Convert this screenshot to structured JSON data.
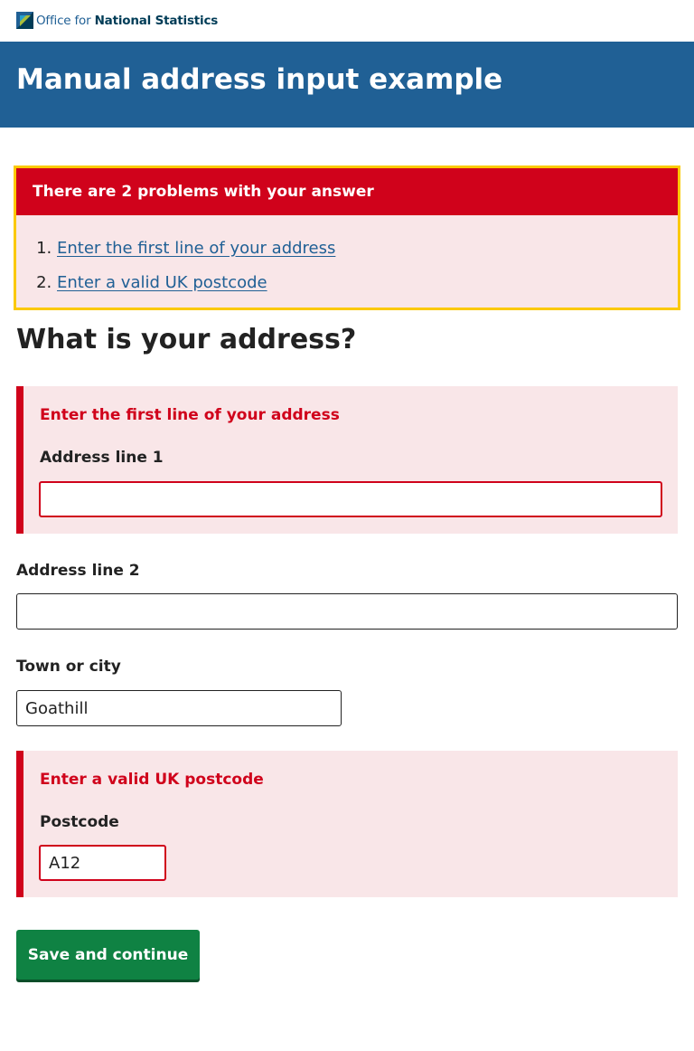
{
  "brand": {
    "logo_prefix": "Office for ",
    "logo_bold": "National Statistics"
  },
  "page": {
    "title": "Manual address input example"
  },
  "error_summary": {
    "heading": "There are 2 problems with your answer",
    "items": [
      "Enter the first line of your address",
      "Enter a valid UK postcode"
    ]
  },
  "question": "What is your address?",
  "fields": {
    "address_line_1": {
      "error": "Enter the first line of your address",
      "label": "Address line 1",
      "value": ""
    },
    "address_line_2": {
      "label": "Address line 2",
      "value": ""
    },
    "town": {
      "label": "Town or city",
      "value": "Goathill"
    },
    "postcode": {
      "error": "Enter a valid UK postcode",
      "label": "Postcode",
      "value": "A12"
    }
  },
  "actions": {
    "save_label": "Save and continue"
  },
  "colors": {
    "brand_blue": "#206095",
    "error_red": "#d0021b",
    "error_bg": "#f9e6e8",
    "focus_yellow": "#fbc900",
    "button_green": "#0f8243"
  }
}
